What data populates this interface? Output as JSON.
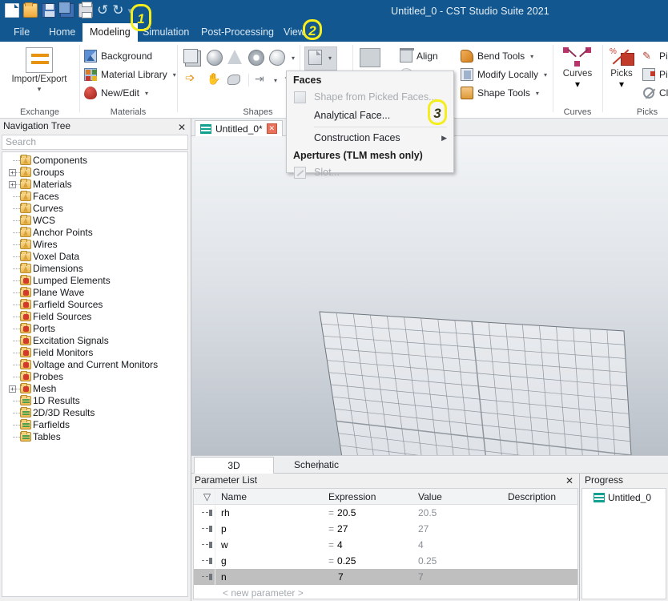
{
  "window": {
    "title": "Untitled_0 - CST Studio Suite 2021",
    "quick_access": [
      {
        "name": "new-icon",
        "label": "New"
      },
      {
        "name": "open-icon",
        "label": "Open"
      },
      {
        "name": "save-icon",
        "label": "Save"
      },
      {
        "name": "save-all-icon",
        "label": "Save All"
      },
      {
        "name": "print-icon",
        "label": "Print"
      },
      {
        "name": "undo-icon",
        "label": "Undo"
      },
      {
        "name": "redo-icon",
        "label": "Redo"
      }
    ],
    "qat_overflow": "▾"
  },
  "tabs": [
    {
      "label": "File",
      "active": false
    },
    {
      "label": "Home",
      "active": false
    },
    {
      "label": "Modeling",
      "active": true
    },
    {
      "label": "Simulation",
      "active": false
    },
    {
      "label": "Post-Processing",
      "active": false
    },
    {
      "label": "View",
      "active": false
    }
  ],
  "ribbon": {
    "exchange": {
      "group_label": "Exchange",
      "import_export": "Import/Export",
      "caret": "▾"
    },
    "materials": {
      "group_label": "Materials",
      "items": [
        {
          "label": "Background",
          "icon": "background-icon",
          "has_dropdown": false
        },
        {
          "label": "Material Library",
          "icon": "material-library-icon",
          "has_dropdown": true
        },
        {
          "label": "New/Edit",
          "icon": "new-edit-icon",
          "has_dropdown": true
        }
      ]
    },
    "shapes": {
      "group_label": "Shapes",
      "primitives": [
        "brick-icon",
        "sphere-icon",
        "cone-icon",
        "torus-icon",
        "ellipsoid-icon"
      ],
      "primitives_caret": "▾",
      "faces_button": "faces-icon",
      "faces_caret": "▾",
      "transforms": [
        "transform-icon",
        "bend-icon",
        "blend-icon",
        "mirror-icon",
        "mirror-caret",
        "rotate-icon"
      ]
    },
    "tools": {
      "align": "Align",
      "align_icon": "align-icon",
      "bend_tools": "Bend Tools",
      "modify_locally": "Modify Locally",
      "shape_tools": "Shape Tools",
      "caret": "▾"
    },
    "curves": {
      "group_label": "Curves",
      "label": "Curves",
      "caret": "▾"
    },
    "picks": {
      "group_label": "Picks",
      "label": "Picks",
      "caret": "▾",
      "items": [
        {
          "label": "Pick P",
          "icon": "pick-point-icon"
        },
        {
          "label": "Pick E",
          "icon": "pick-edge-icon"
        },
        {
          "label": "Clear",
          "icon": "clear-picks-icon"
        }
      ]
    }
  },
  "faces_menu": {
    "header_faces": "Faces",
    "header_apertures": "Apertures (TLM mesh only)",
    "items": [
      {
        "label": "Shape from Picked Faces...",
        "disabled": true,
        "icon": "face-icon",
        "submenu": false
      },
      {
        "label": "Analytical Face...",
        "disabled": false,
        "icon": "",
        "submenu": false
      },
      {
        "label": "Construction Faces",
        "disabled": false,
        "icon": "",
        "submenu": true
      },
      {
        "label": "Slot...",
        "disabled": true,
        "icon": "slot-icon",
        "submenu": false
      }
    ],
    "submenu_arrow": "▶"
  },
  "navigation": {
    "title": "Navigation Tree",
    "close": "✕",
    "search_placeholder": "Search",
    "items": [
      {
        "label": "Components",
        "expandable": false,
        "icon": "folder-cone-icon"
      },
      {
        "label": "Groups",
        "expandable": true,
        "icon": "folder-cone-icon"
      },
      {
        "label": "Materials",
        "expandable": true,
        "icon": "folder-cone-icon"
      },
      {
        "label": "Faces",
        "expandable": false,
        "icon": "folder-cone-icon"
      },
      {
        "label": "Curves",
        "expandable": false,
        "icon": "folder-cone-icon"
      },
      {
        "label": "WCS",
        "expandable": false,
        "icon": "folder-cone-icon"
      },
      {
        "label": "Anchor Points",
        "expandable": false,
        "icon": "folder-cone-icon"
      },
      {
        "label": "Wires",
        "expandable": false,
        "icon": "folder-cone-icon"
      },
      {
        "label": "Voxel Data",
        "expandable": false,
        "icon": "folder-cone-icon"
      },
      {
        "label": "Dimensions",
        "expandable": false,
        "icon": "folder-cone-icon"
      },
      {
        "label": "Lumped Elements",
        "expandable": false,
        "icon": "folder-gear-icon"
      },
      {
        "label": "Plane Wave",
        "expandable": false,
        "icon": "folder-gear-icon"
      },
      {
        "label": "Farfield Sources",
        "expandable": false,
        "icon": "folder-gear-icon"
      },
      {
        "label": "Field Sources",
        "expandable": false,
        "icon": "folder-gear-icon"
      },
      {
        "label": "Ports",
        "expandable": false,
        "icon": "folder-gear-icon"
      },
      {
        "label": "Excitation Signals",
        "expandable": false,
        "icon": "folder-gear-icon"
      },
      {
        "label": "Field Monitors",
        "expandable": false,
        "icon": "folder-gear-icon"
      },
      {
        "label": "Voltage and Current Monitors",
        "expandable": false,
        "icon": "folder-gear-icon"
      },
      {
        "label": "Probes",
        "expandable": false,
        "icon": "folder-gear-icon"
      },
      {
        "label": "Mesh",
        "expandable": true,
        "icon": "folder-gear-icon"
      },
      {
        "label": "1D Results",
        "expandable": false,
        "icon": "folder-results-icon"
      },
      {
        "label": "2D/3D Results",
        "expandable": false,
        "icon": "folder-results-icon"
      },
      {
        "label": "Farfields",
        "expandable": false,
        "icon": "folder-results-icon"
      },
      {
        "label": "Tables",
        "expandable": false,
        "icon": "folder-results-icon"
      }
    ],
    "expand_glyph": "+"
  },
  "document": {
    "tab_label": "Untitled_0*",
    "tab_icon": "cst-document-icon",
    "tab_close": "✕"
  },
  "view_tabs": [
    {
      "label": "3D",
      "selected": true
    },
    {
      "label": "Schematic",
      "selected": false
    }
  ],
  "parameter_list": {
    "title": "Parameter List",
    "close": "✕",
    "columns": [
      "",
      "Name",
      "Expression",
      "Value",
      "Description"
    ],
    "filter_icon": "filter-icon",
    "rows": [
      {
        "name": "rh",
        "expression": "20.5",
        "eq": "=",
        "value": "20.5",
        "description": "",
        "selected": false
      },
      {
        "name": "p",
        "expression": "27",
        "eq": "=",
        "value": "27",
        "description": "",
        "selected": false
      },
      {
        "name": "w",
        "expression": "4",
        "eq": "=",
        "value": "4",
        "description": "",
        "selected": false
      },
      {
        "name": "g",
        "expression": "0.25",
        "eq": "=",
        "value": "0.25",
        "description": "",
        "selected": false
      },
      {
        "name": "n",
        "expression": "7",
        "eq": "",
        "value": "7",
        "description": "",
        "selected": true
      }
    ],
    "new_row": "< new parameter >"
  },
  "progress": {
    "title": "Progress",
    "item": "Untitled_0",
    "item_icon": "cst-document-icon"
  },
  "annotations": [
    {
      "label": "1"
    },
    {
      "label": "2"
    },
    {
      "label": "3"
    }
  ],
  "colors": {
    "titlebar": "#12578f",
    "accent_yellow": "#f5ee1c",
    "selection_gray": "#bfbfbf"
  }
}
